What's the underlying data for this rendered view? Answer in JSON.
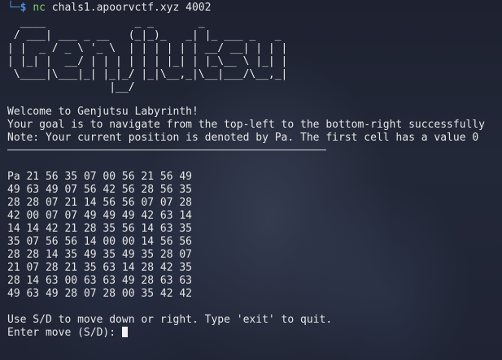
{
  "prompt": {
    "corner": "└─",
    "dollar": "$",
    "command": "nc",
    "args": "chals1.apoorvctf.xyz 4002"
  },
  "banner_lines": [
    "  ____              _ _       _",
    " / ___| ___ _ __   (_|_)_   _| |_ ___ _   _",
    "| |  _ / _ \\ '_ \\  | | | | | | __/ __| | | |",
    "| |_| |  __/ | | | | | | |_| | |_\\__ \\ |_| |",
    " \\____|\\___|_| |_|_/ |_|\\__,_|\\__|___/\\__,_|",
    "                |__/"
  ],
  "messages": {
    "welcome": "Welcome to Genjutsu Labyrinth!",
    "goal": "Your goal is to navigate from the top-left to the bottom-right successfully",
    "note": "Note: Your current position is denoted by Pa. The first cell has a value 0"
  },
  "grid": [
    [
      "Pa",
      "21",
      "56",
      "35",
      "07",
      "00",
      "56",
      "21",
      "56",
      "49"
    ],
    [
      "49",
      "63",
      "49",
      "07",
      "56",
      "42",
      "56",
      "28",
      "56",
      "35"
    ],
    [
      "28",
      "28",
      "07",
      "21",
      "14",
      "56",
      "56",
      "07",
      "07",
      "28"
    ],
    [
      "42",
      "00",
      "07",
      "07",
      "49",
      "49",
      "49",
      "42",
      "63",
      "14"
    ],
    [
      "14",
      "14",
      "42",
      "21",
      "28",
      "35",
      "56",
      "14",
      "63",
      "35"
    ],
    [
      "35",
      "07",
      "56",
      "56",
      "14",
      "00",
      "00",
      "14",
      "56",
      "56"
    ],
    [
      "28",
      "28",
      "14",
      "35",
      "49",
      "35",
      "49",
      "35",
      "28",
      "07"
    ],
    [
      "21",
      "07",
      "28",
      "21",
      "35",
      "63",
      "14",
      "28",
      "42",
      "35"
    ],
    [
      "28",
      "14",
      "63",
      "00",
      "63",
      "63",
      "49",
      "28",
      "63",
      "63"
    ],
    [
      "49",
      "63",
      "49",
      "28",
      "07",
      "28",
      "00",
      "35",
      "42",
      "42"
    ]
  ],
  "instructions": "Use S/D to move down or right. Type 'exit' to quit.",
  "input_prompt": "Enter move (S/D): "
}
